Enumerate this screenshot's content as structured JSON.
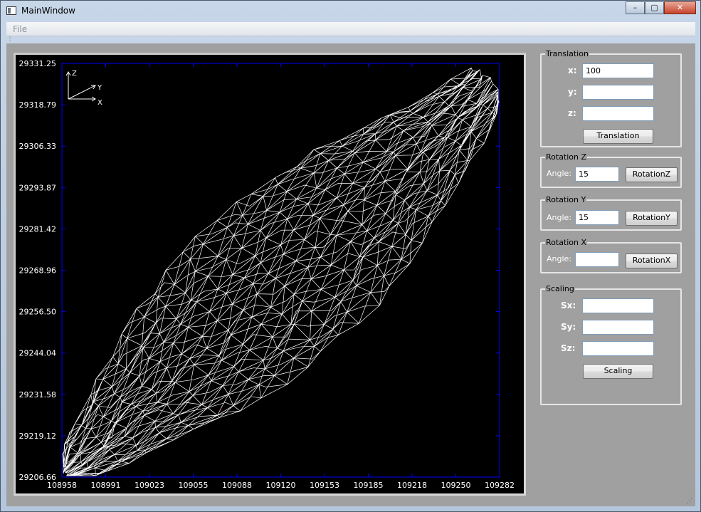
{
  "window": {
    "title": "MainWindow",
    "minimize": "–",
    "maximize": "▢",
    "close": "✕"
  },
  "menu": {
    "file": "File"
  },
  "plot": {
    "y_ticks": [
      "29331.25",
      "29318.79",
      "29306.33",
      "29293.87",
      "29281.42",
      "29268.96",
      "29256.50",
      "29244.04",
      "29231.58",
      "29219.12",
      "29206.66"
    ],
    "x_ticks": [
      "108958",
      "108991",
      "109023",
      "109055",
      "109088",
      "109120",
      "109153",
      "109185",
      "109218",
      "109250",
      "109282"
    ],
    "axis_labels": {
      "z": "Z",
      "y": "Y",
      "x": "X"
    },
    "colors": {
      "background": "#000000",
      "frame": "#0000ff",
      "mesh": "#ffffff",
      "labels": "#ffffff"
    }
  },
  "translation": {
    "title": "Translation",
    "x_label": "x:",
    "x_value": "100",
    "y_label": "y:",
    "y_value": "",
    "z_label": "z:",
    "z_value": "",
    "button": "Translation"
  },
  "rotation_z": {
    "title": "Rotation Z",
    "angle_label": "Angle:",
    "angle_value": "15",
    "button": "RotationZ"
  },
  "rotation_y": {
    "title": "Rotation Y",
    "angle_label": "Angle:",
    "angle_value": "15",
    "button": "RotationY"
  },
  "rotation_x": {
    "title": "Rotation X",
    "angle_label": "Angle:",
    "angle_value": "",
    "button": "RotationX"
  },
  "scaling": {
    "title": "Scaling",
    "sx_label": "Sx:",
    "sx_value": "",
    "sy_label": "Sy:",
    "sy_value": "",
    "sz_label": "Sz:",
    "sz_value": "",
    "button": "Scaling"
  }
}
